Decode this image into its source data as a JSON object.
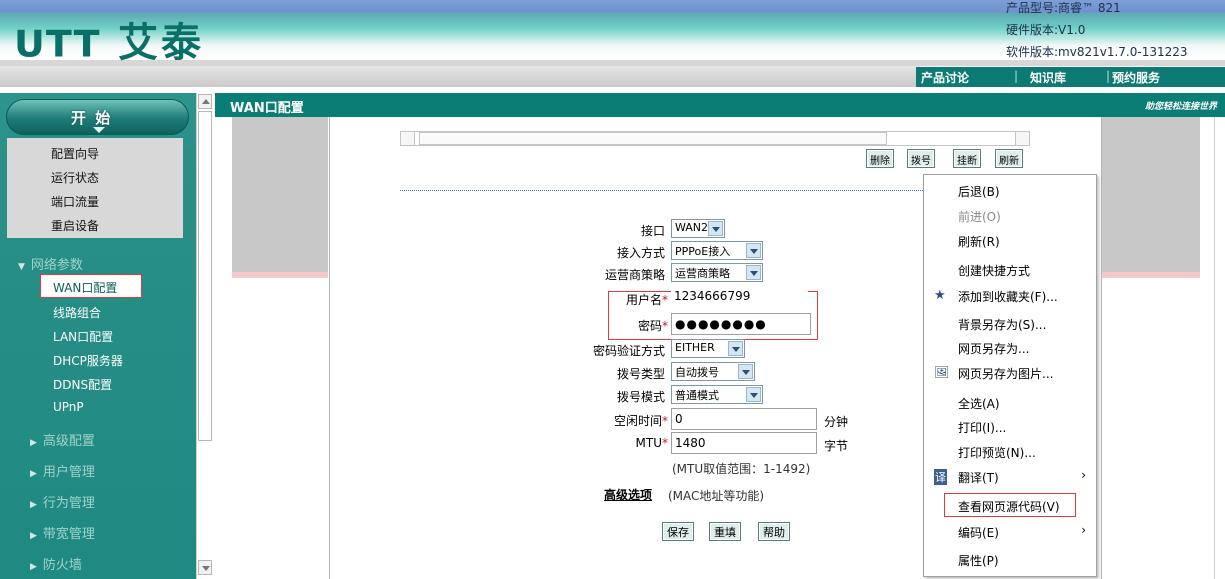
{
  "header": {
    "logo_mark": "UTT",
    "logo_text": "艾泰",
    "product_model": "产品型号:商睿™ 821",
    "hardware_version": "硬件版本:V1.0",
    "software_version": "软件版本:mv821v1.7.0-131223",
    "nav": [
      "产品讨论",
      "知识库",
      "预约服务"
    ],
    "nav_sep": "|"
  },
  "sidebar": {
    "start_label": "开 始",
    "quick_items": [
      "配置向导",
      "运行状态",
      "端口流量",
      "重启设备"
    ],
    "groups": [
      {
        "label": "网络参数",
        "expanded": true,
        "items": [
          "WAN口配置",
          "线路组合",
          "LAN口配置",
          "DHCP服务器",
          "DDNS配置",
          "UPnP"
        ]
      },
      {
        "label": "高级配置",
        "expanded": false
      },
      {
        "label": "用户管理",
        "expanded": false
      },
      {
        "label": "行为管理",
        "expanded": false
      },
      {
        "label": "带宽管理",
        "expanded": false
      },
      {
        "label": "防火墙",
        "expanded": false
      }
    ],
    "selected_item": "WAN口配置"
  },
  "main": {
    "title": "WAN口配置",
    "slogan": "助您轻松连接世界",
    "list_buttons": [
      "删除",
      "拨号",
      "挂断",
      "刷新"
    ],
    "form": {
      "interface_label": "接口",
      "interface_value": "WAN2",
      "access_label": "接入方式",
      "access_value": "PPPoE接入",
      "isp_label": "运营商策略",
      "isp_value": "运营商策略",
      "username_label": "用户名",
      "username_value": "1234666799",
      "password_label": "密码",
      "password_value": "●●●●●●●●",
      "auth_label": "密码验证方式",
      "auth_value": "EITHER",
      "dial_type_label": "拨号类型",
      "dial_type_value": "自动拨号",
      "dial_mode_label": "拨号模式",
      "dial_mode_value": "普通模式",
      "idle_label": "空闲时间",
      "idle_value": "0",
      "idle_unit": "分钟",
      "mtu_label": "MTU",
      "mtu_value": "1480",
      "mtu_unit": "字节",
      "mtu_hint": "(MTU取值范围：1-1492)",
      "required_mark": "*",
      "advanced_label": "高级选项",
      "advanced_hint": "(MAC地址等功能)"
    },
    "form_buttons": [
      "保存",
      "重填",
      "帮助"
    ]
  },
  "context_menu": {
    "items": [
      {
        "label": "后退(B)",
        "disabled": false
      },
      {
        "label": "前进(O)",
        "disabled": true
      },
      {
        "label": "刷新(R)",
        "disabled": false
      },
      {
        "label": "创建快捷方式",
        "disabled": false
      },
      {
        "label": "添加到收藏夹(F)...",
        "disabled": false,
        "icon": "star-icon"
      },
      {
        "label": "背景另存为(S)...",
        "disabled": false
      },
      {
        "label": "网页另存为...",
        "disabled": false
      },
      {
        "label": "网页另存为图片...",
        "disabled": false,
        "icon": "image-icon"
      },
      {
        "label": "全选(A)",
        "disabled": false
      },
      {
        "label": "打印(I)...",
        "disabled": false
      },
      {
        "label": "打印预览(N)...",
        "disabled": false
      },
      {
        "label": "翻译(T)",
        "disabled": false,
        "icon": "translate-icon",
        "submenu": true
      },
      {
        "label": "查看网页源代码(V)",
        "disabled": false,
        "highlighted": true
      },
      {
        "label": "编码(E)",
        "disabled": false,
        "submenu": true
      },
      {
        "label": "属性(P)",
        "disabled": false
      }
    ],
    "submenu_arrow": "›",
    "star_glyph": "★",
    "image_glyph": "🖼",
    "translate_glyph": "译"
  },
  "colors": {
    "brand_teal": "#0a7d75",
    "highlight_red": "#e23a3a",
    "required_red": "#d01313"
  }
}
